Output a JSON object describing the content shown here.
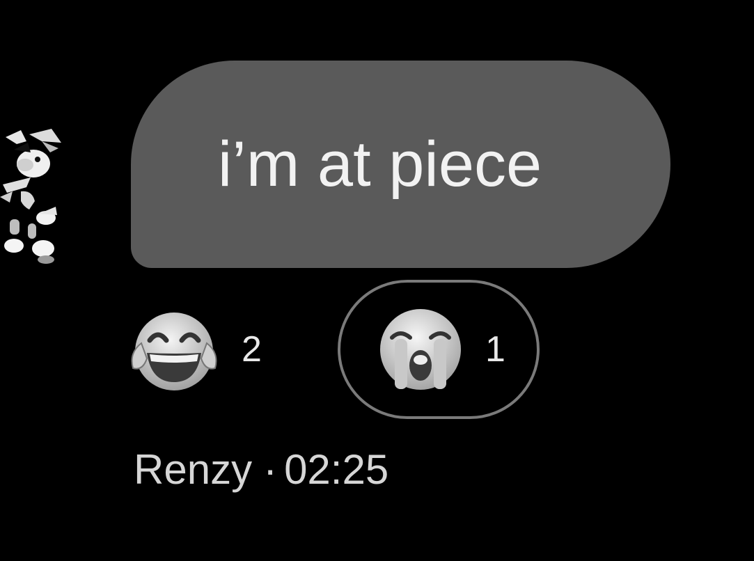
{
  "message": {
    "text": "i’m at piece",
    "bubble_color": "#5a5a5a"
  },
  "avatar": {
    "icon": "cartoon-character-avatar-icon"
  },
  "reactions": [
    {
      "emoji_name": "face-with-tears-of-joy-icon",
      "count": "2",
      "selected": false
    },
    {
      "emoji_name": "loudly-crying-face-icon",
      "count": "1",
      "selected": true
    }
  ],
  "meta": {
    "sender": "Renzy",
    "separator": "·",
    "time": "02:25"
  }
}
